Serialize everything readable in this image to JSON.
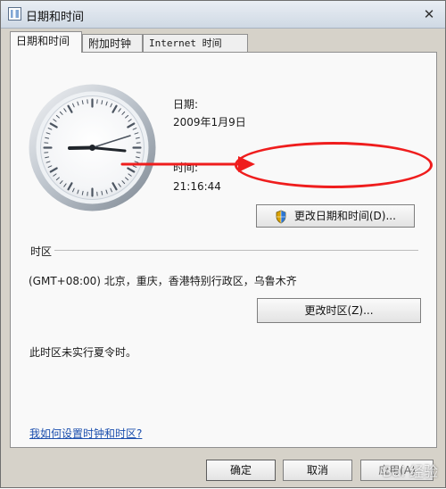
{
  "window": {
    "title": "日期和时间",
    "close_symbol": "✕"
  },
  "tabs": [
    {
      "label": "日期和时间"
    },
    {
      "label": "附加时钟"
    },
    {
      "label": "Internet 时间"
    }
  ],
  "datetime": {
    "date_label": "日期:",
    "date_value": "2009年1月9日",
    "time_label": "时间:",
    "time_value": "21:16:44",
    "change_button": "更改日期和时间(D)..."
  },
  "timezone": {
    "section_title": "时区",
    "value": "(GMT+08:00) 北京，重庆，香港特别行政区，乌鲁木齐",
    "change_button": "更改时区(Z)...",
    "dst_note": "此时区未实行夏令时。"
  },
  "help": {
    "link_text": "我如何设置时钟和时区?"
  },
  "footer": {
    "ok": "确定",
    "cancel": "取消",
    "apply": "应用(A)"
  },
  "watermark": {
    "text": "Bai 经验"
  },
  "icons": {
    "window": "calendar-icon",
    "close": "close-icon",
    "shield": "shield-icon",
    "clock": "analog-clock-icon"
  },
  "colors": {
    "annotation_red": "#ef1d1d",
    "link_blue": "#1c4fae"
  }
}
